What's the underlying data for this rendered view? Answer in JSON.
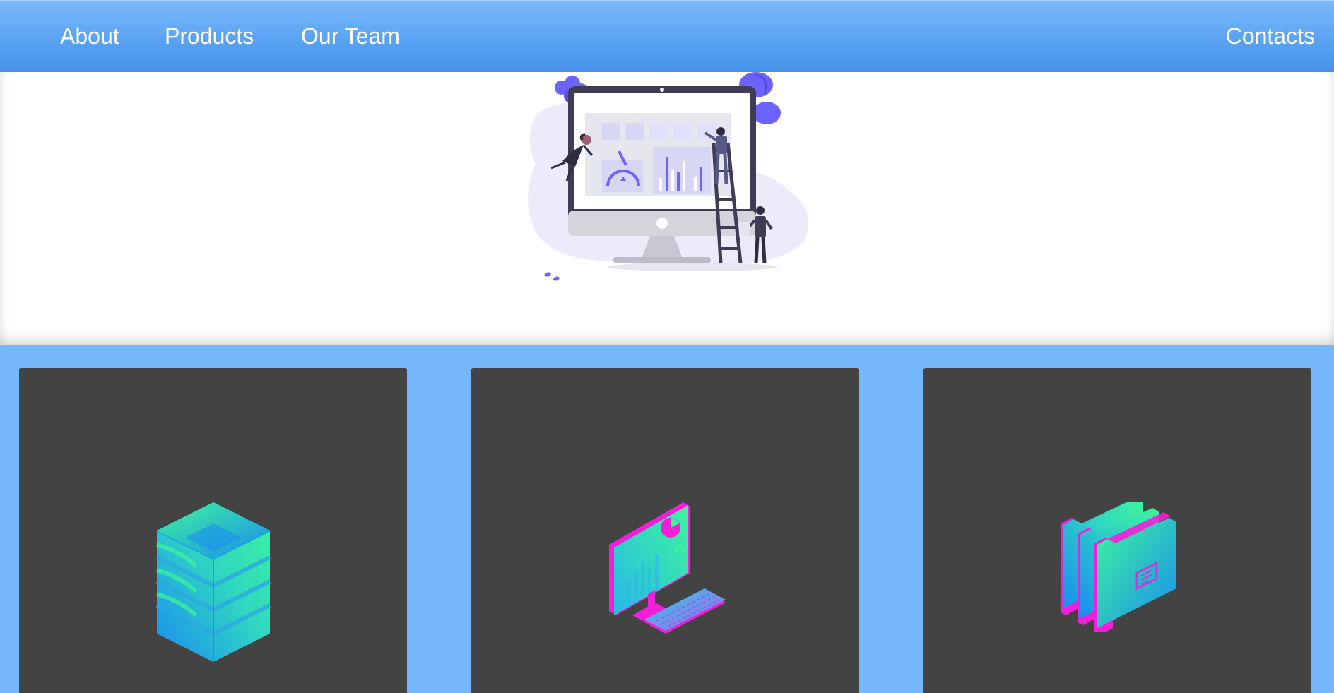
{
  "nav": {
    "about": "About",
    "products": "Products",
    "team": "Our Team",
    "contacts": "Contacts"
  },
  "hero": {
    "illustration": "dashboard-monitor-team-illustration"
  },
  "cards": [
    {
      "icon": "database-stack-icon"
    },
    {
      "icon": "computer-analytics-icon"
    },
    {
      "icon": "folders-icon"
    }
  ],
  "colors": {
    "nav_top": "#7ab9fb",
    "nav_bottom": "#4592ea",
    "page_background": "#76b6fb",
    "card_background": "#434343",
    "hero_background": "#ffffff",
    "illustration_accent": "#6c63ff",
    "icon_gradient_green": "#3df59a",
    "icon_gradient_blue": "#1a8cf0",
    "icon_gradient_magenta": "#f21fd8"
  }
}
